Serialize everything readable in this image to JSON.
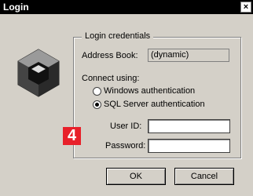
{
  "window": {
    "title": "Login",
    "close_glyph": "×"
  },
  "logo": {
    "icon": "cube-logo-icon"
  },
  "group": {
    "legend": "Login credentials"
  },
  "address_book": {
    "label": "Address Book:",
    "value": "(dynamic)"
  },
  "connect": {
    "label": "Connect using:",
    "options": [
      {
        "label": "Windows authentication",
        "selected": false
      },
      {
        "label": "SQL Server authentication",
        "selected": true
      }
    ]
  },
  "fields": {
    "user_id": {
      "label": "User ID:",
      "value": ""
    },
    "password": {
      "label": "Password:",
      "value": ""
    }
  },
  "step_badge": "4",
  "buttons": {
    "ok": "OK",
    "cancel": "Cancel"
  }
}
